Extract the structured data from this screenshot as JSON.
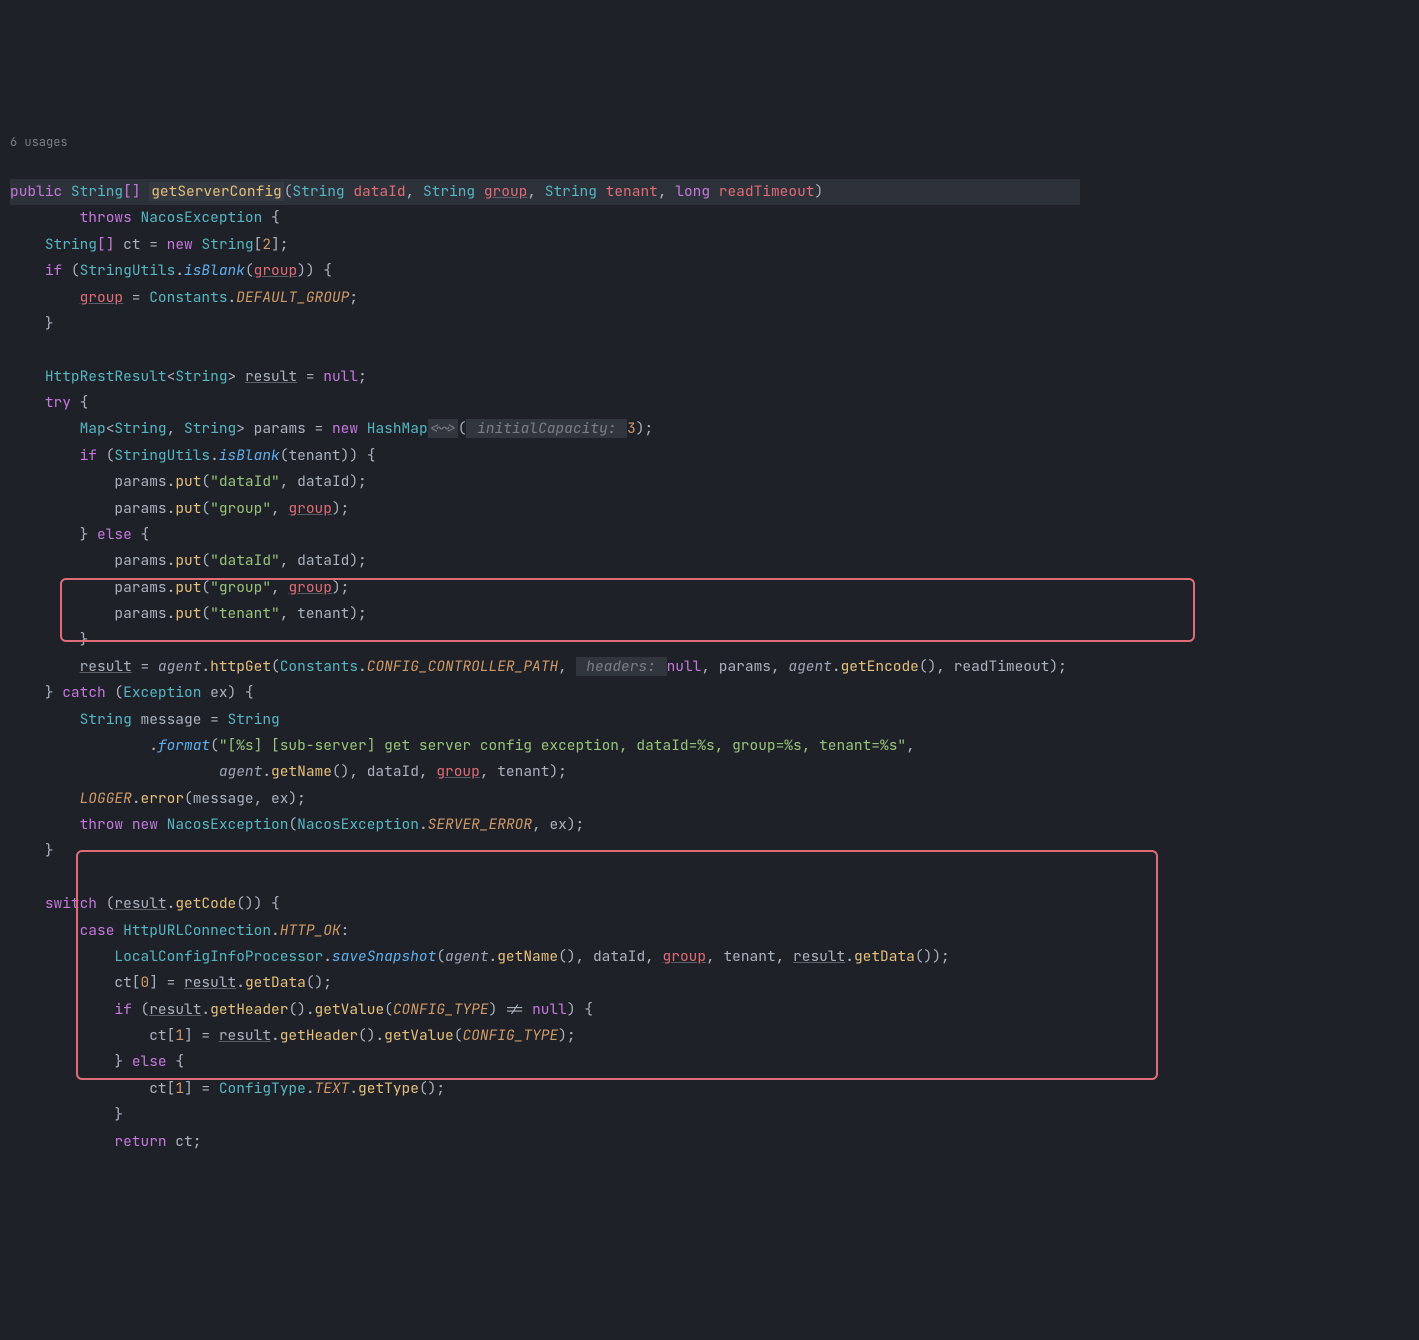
{
  "usages": "6 usages",
  "code": {
    "l1": {
      "public": "public",
      "string": "String",
      "brackets": "[]",
      "method": "getServerConfig",
      "p": "(",
      "s1": "String",
      "dataId": "dataId",
      "c1": ", ",
      "s2": "String",
      "group": "group",
      "c2": ", ",
      "s3": "String",
      "tenant": "tenant",
      "c3": ", ",
      "long": "long",
      "readTimeout": "readTimeout",
      "close": ")"
    },
    "l2": {
      "throws": "throws",
      "ex": "NacosException",
      "brace": "{"
    },
    "l3": {
      "type": "String",
      "br": "[]",
      "ct": "ct = ",
      "new": "new",
      "type2": "String",
      "br2": "[",
      "n": "2",
      "close": "];"
    },
    "l4": {
      "if": "if",
      "open": "(",
      "su": "StringUtils",
      "dot": ".",
      "isBlank": "isBlank",
      "p": "(",
      "group": "group",
      "close": ")) {"
    },
    "l5": {
      "grp": "group",
      "eq": " = ",
      "c": "Constants",
      "dot": ".",
      "dg": "DEFAULT_GROUP",
      "semi": ";"
    },
    "l6": {
      "brace": "}"
    },
    "l7": {
      "type": "HttpRestResult",
      "lt": "<",
      "s": "String",
      "gt": "> ",
      "res": "result",
      "eq": " = ",
      "null": "null",
      "semi": ";"
    },
    "l8": {
      "try": "try",
      "brace": " {"
    },
    "l9": {
      "map": "Map",
      "lt": "<",
      "s1": "String",
      "c": ", ",
      "s2": "String",
      "gt": "> ",
      "p": "params = ",
      "new": "new",
      "hm": " HashMap",
      "hint1": "<~>",
      "po": "(",
      "hint2": " initialCapacity: ",
      "n": "3",
      "close": ");"
    },
    "l10": {
      "if": "if",
      "open": " (",
      "su": "StringUtils",
      "dot": ".",
      "isBlank": "isBlank",
      "p": "(",
      "tenant": "tenant",
      "close": ")) {"
    },
    "l11": {
      "p": "params.",
      "put": "put",
      "po": "(",
      "str": "\"dataId\"",
      "c": ", ",
      "v": "dataId",
      "close": ");"
    },
    "l12": {
      "p": "params.",
      "put": "put",
      "po": "(",
      "str": "\"group\"",
      "c": ", ",
      "v": "group",
      "close": ");"
    },
    "l13": {
      "brace": "} ",
      "else": "else",
      "open": " {"
    },
    "l14": {
      "p": "params.",
      "put": "put",
      "po": "(",
      "str": "\"dataId\"",
      "c": ", ",
      "v": "dataId",
      "close": ");"
    },
    "l15": {
      "p": "params.",
      "put": "put",
      "po": "(",
      "str": "\"group\"",
      "c": ", ",
      "v": "group",
      "close": ");"
    },
    "l16": {
      "p": "params.",
      "put": "put",
      "po": "(",
      "str": "\"tenant\"",
      "c": ", ",
      "v": "tenant",
      "close": ");"
    },
    "l17": {
      "brace": "}"
    },
    "l18": {
      "res": "result",
      "eq": " = ",
      "agent": "agent",
      "dot": ".",
      "hg": "httpGet",
      "po": "(",
      "c": "Constants",
      "d2": ".",
      "ccp": "CONFIG_CONTROLLER_PATH",
      "comma": ", ",
      "hint": " headers: ",
      "null": "null",
      "c2": ", params, ",
      "a2": "agent",
      "d3": ".",
      "ge": "getEncode",
      "pc": "(), readTimeout);"
    },
    "l19": {
      "cbrace": "} ",
      "catch": "catch",
      "popen": " (",
      "ex": "Exception ",
      "exv": "ex",
      "close": ") {"
    },
    "l20": {
      "s": "String",
      "msg": " message = ",
      "s2": "String"
    },
    "l21": {
      "dot": ".",
      "fmt": "format",
      "po": "(",
      "str": "\"[%s] [sub-server] get server config exception, dataId=%s, group=%s, tenant=%s\"",
      "c": ","
    },
    "l22": {
      "a": "agent",
      "dot": ".",
      "gn": "getName",
      "rest": "(), dataId, ",
      "grp": "group",
      "rest2": ", tenant);"
    },
    "l23": {
      "log": "LOGGER",
      "dot": ".",
      "err": "error",
      "rest": "(message, ex);"
    },
    "l24": {
      "throw": "throw",
      "new": "new",
      "ne": "NacosException",
      "po": "(",
      "ne2": "NacosException",
      "dot": ".",
      "se": "SERVER_ERROR",
      "rest": ", ex);"
    },
    "l25": {
      "brace": "}"
    },
    "l26": {
      "switch": "switch",
      "po": " (",
      "res": "result",
      "dot": ".",
      "gc": "getCode",
      "close": "()) {"
    },
    "l27": {
      "case": "case",
      "huc": " HttpURLConnection",
      "dot": ".",
      "ok": "HTTP_OK",
      "colon": ":"
    },
    "l28": {
      "lcip": "LocalConfigInfoProcessor",
      "dot": ".",
      "ss": "saveSnapshot",
      "po": "(",
      "a": "agent",
      "d2": ".",
      "gn": "getName",
      "rest": "(), dataId, ",
      "grp": "group",
      "c2": ", tenant, ",
      "res": "result",
      "d3": ".",
      "gd": "getData",
      "close": "());"
    },
    "l29": {
      "ct": "ct[",
      "n": "0",
      "rest": "] = ",
      "res": "result",
      "dot": ".",
      "gd": "getData",
      "close": "();"
    },
    "l30": {
      "if": "if",
      "po": " (",
      "res": "result",
      "dot": ".",
      "gh": "getHeader",
      "rest": "().",
      "gv": "getValue",
      "po2": "(",
      "ctv": "CONFIG_TYPE",
      "close": ") != ",
      "null": "null",
      "brace": ") {"
    },
    "l31": {
      "ct": "ct[",
      "n": "1",
      "rest": "] = ",
      "res": "result",
      "dot": ".",
      "gh": "getHeader",
      "rest2": "().",
      "gv": "getValue",
      "po": "(",
      "ctv": "CONFIG_TYPE",
      "close": ");"
    },
    "l32": {
      "brace": "} ",
      "else": "else",
      "open": " {"
    },
    "l33": {
      "ct": "ct[",
      "n": "1",
      "rest": "] = ",
      "ctype": "ConfigType",
      "dot": ".",
      "txt": "TEXT",
      "d2": ".",
      "gt": "getType",
      "close": "();"
    },
    "l34": {
      "brace": "}"
    },
    "l35": {
      "ret": "return",
      "rest": " ct;"
    }
  }
}
